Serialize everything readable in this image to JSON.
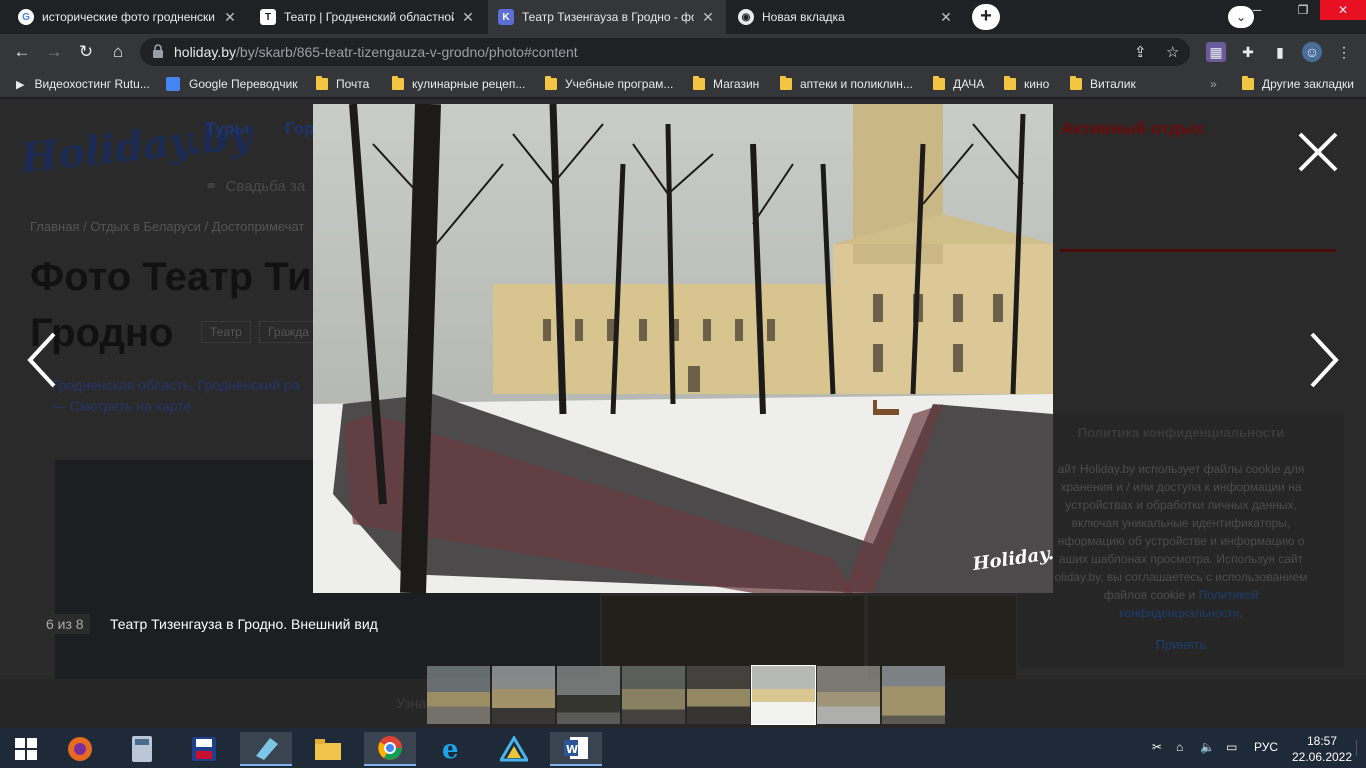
{
  "tabs": [
    {
      "title": "исторические фото гродненски",
      "favicon": "google-icon",
      "active": false
    },
    {
      "title": "Театр | Гродненский областной",
      "favicon": "theatre-icon",
      "active": false
    },
    {
      "title": "Театр Тизенгауза в Гродно - фот",
      "favicon": "holiday-icon",
      "active": true
    },
    {
      "title": "Новая вкладка",
      "favicon": "chrome-icon",
      "active": false
    }
  ],
  "address": {
    "host": "holiday.by",
    "path": "/by/skarb/865-teatr-tizengauza-v-grodno/photo#content"
  },
  "bookmarks": [
    "Видеохостинг Rutu...",
    "Google Переводчик",
    "Почта",
    "кулинарные рецеп...",
    "Учебные програм...",
    "Магазин",
    "аптеки и поликлин...",
    "ДАЧА",
    "кино",
    "Виталик"
  ],
  "bookmarks_overflow": "»",
  "other_bookmarks": "Другие закладки",
  "page": {
    "logo": "Holiday.by",
    "nav": [
      "Туры",
      "Гор",
      "Активный отдых"
    ],
    "wedding": "Свадьба за",
    "breadcrumb": "Главная / Отдых в Беларуси / Достопримечат",
    "heading_line1": "Фото Театр Ти",
    "heading_line2": "Гродно",
    "tags": [
      "Театр",
      "Гражда"
    ],
    "location_line1": "Гродненская область, Гродненский ра",
    "location_line2": "— Смотреть на карте",
    "bottom_text": "Узна"
  },
  "cookie": {
    "title": "Политика конфиденциальности",
    "body": "айт Holiday.by использует файлы cookie для хранения и / или доступа к информации на устройствах и обработки личных данных, включая уникальные идентификаторы, нформацию об устройстве и информацию о аших шаблонах просмотра. Используя сайт oliday.by, вы соглашаетесь с использованием файлов cookie и",
    "link": "Политикой конфиденциальности",
    "link_suffix": ".",
    "accept": "Принять"
  },
  "lightbox": {
    "counter": "6 из 8",
    "caption": "Театр Тизенгауза в Гродно. Внешний вид",
    "watermark": "Holiday.by",
    "thumb_count": 8,
    "current_index": 6
  },
  "taskbar": {
    "apps": [
      "windows-start-icon",
      "firefox-icon",
      "calculator-icon",
      "save-disk-icon",
      "notepad-icon",
      "file-explorer-icon",
      "chrome-icon",
      "internet-explorer-icon",
      "app-triangle-icon",
      "word-icon"
    ],
    "lang": "РУС",
    "time": "18:57",
    "date": "22.06.2022"
  },
  "colors": {
    "chrome_dark": "#202124",
    "chrome_toolbar": "#35363a",
    "taskbar": "#1f2a38",
    "brand_blue": "#1f3570"
  }
}
